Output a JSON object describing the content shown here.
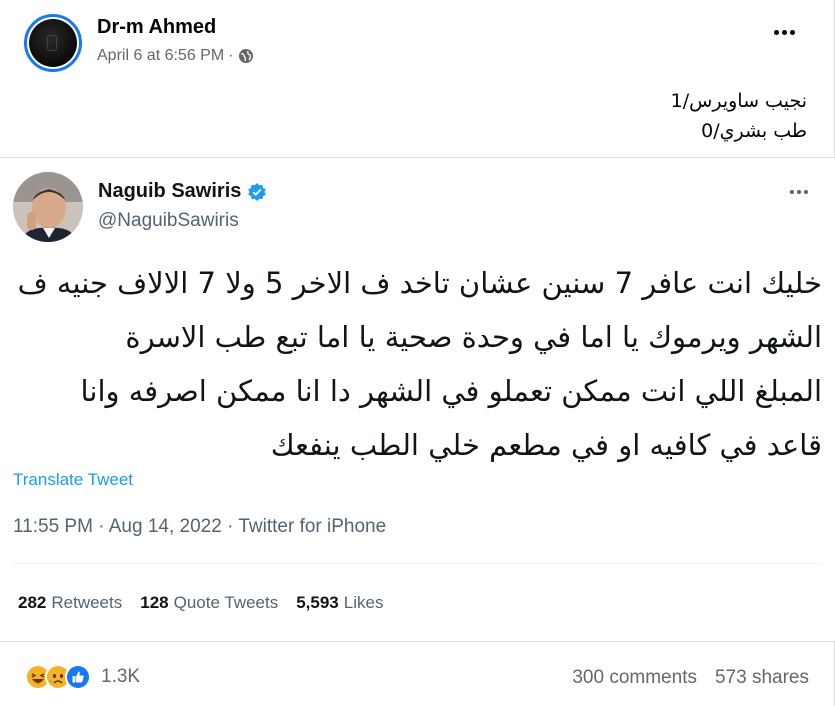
{
  "post": {
    "author": "Dr-m Ahmed",
    "timestamp": "April 6 at 6:56 PM",
    "separator": "·",
    "privacy_icon": "globe-icon",
    "caption_lines": [
      "نجيب ساويرس/1",
      "طب بشري/0"
    ]
  },
  "tweet": {
    "name": "Naguib Sawiris",
    "handle": "@NaguibSawiris",
    "verified_icon": "verified-badge-icon",
    "text_lines": [
      "خليك انت عافر 7 سنين عشان تاخد ف الاخر 5 ولا 7 الالاف جنيه ف",
      "الشهر ويرموك يا اما في وحدة صحية يا اما تبع طب الاسرة",
      "المبلغ اللي انت ممكن تعملو في الشهر دا انا ممكن اصرفه وانا",
      "قاعد في كافيه او في مطعم خلي الطب ينفعك"
    ],
    "translate_label": "Translate Tweet",
    "time_line": "11:55 PM · Aug 14, 2022 · Twitter for iPhone",
    "stats": {
      "retweets_count": "282",
      "retweets_label": "Retweets",
      "quotes_count": "128",
      "quotes_label": "Quote Tweets",
      "likes_count": "5,593",
      "likes_label": "Likes"
    }
  },
  "footer": {
    "reactions": [
      "haha-icon",
      "sad-icon",
      "like-icon"
    ],
    "reaction_count": "1.3K",
    "comments": "300 comments",
    "shares": "573 shares"
  },
  "colors": {
    "fb_blue": "#1877f2",
    "twitter_blue": "#1d9bf0",
    "muted": "#65676b"
  }
}
